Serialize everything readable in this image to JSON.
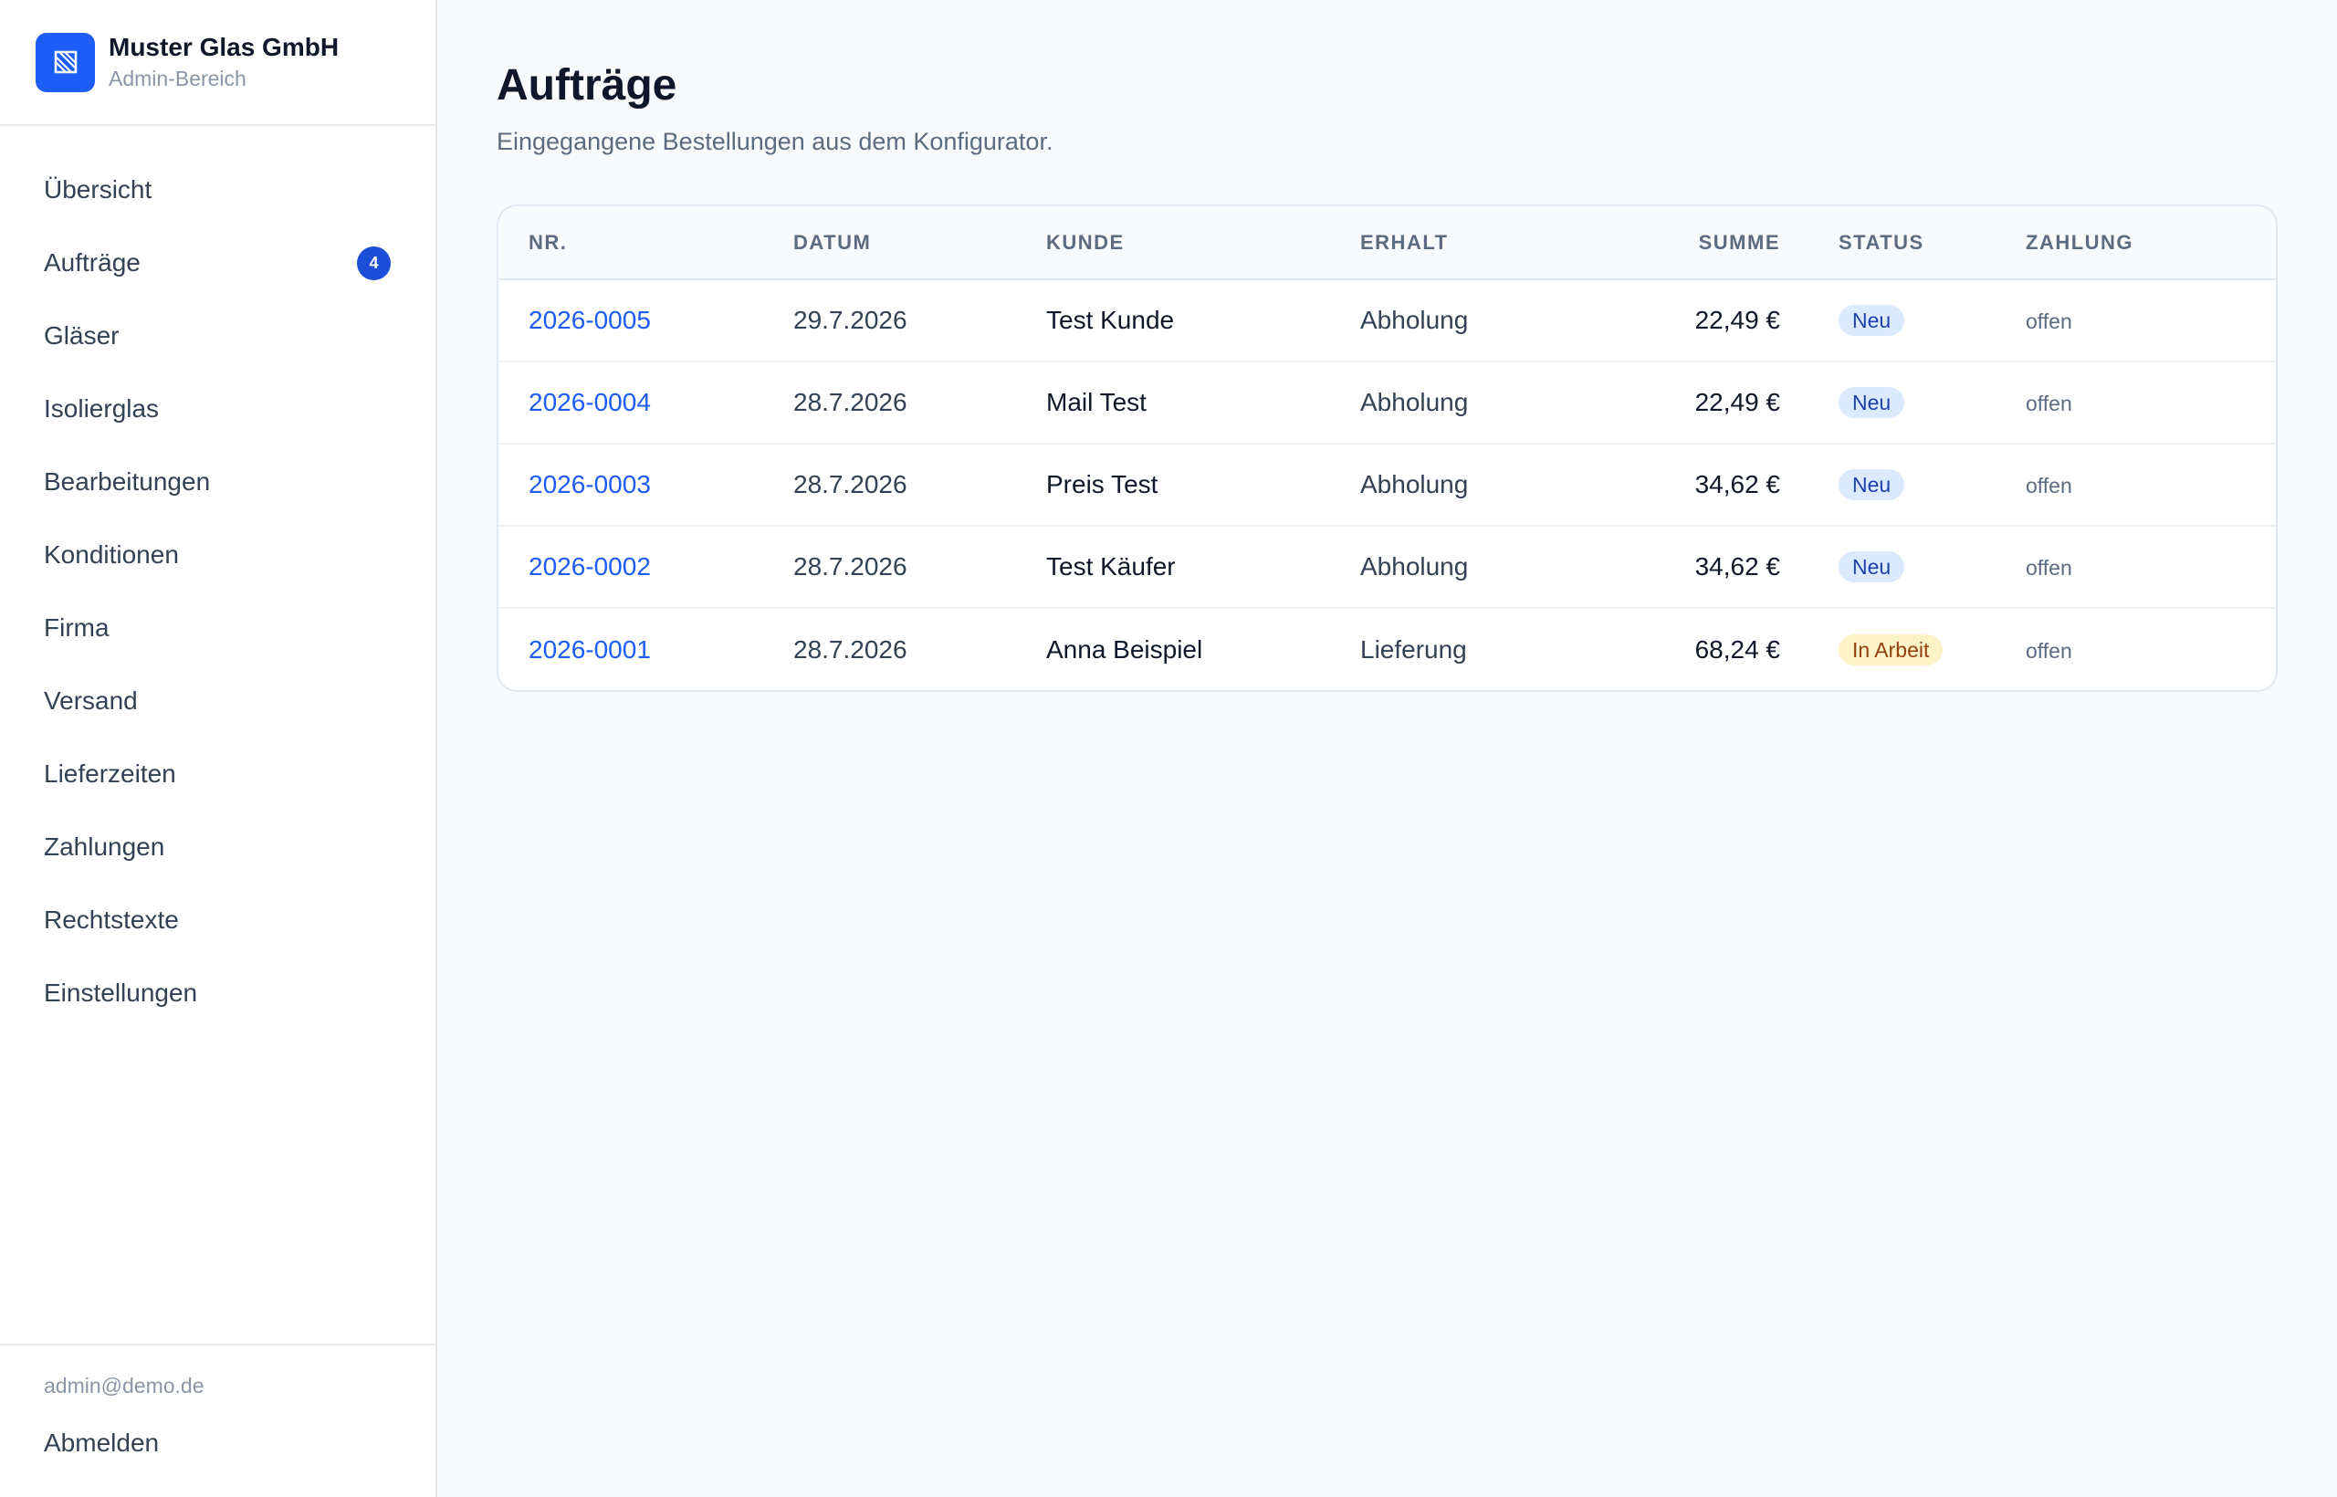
{
  "brand": {
    "name": "Muster Glas GmbH",
    "subtitle": "Admin-Bereich"
  },
  "nav": [
    {
      "label": "Übersicht"
    },
    {
      "label": "Aufträge",
      "badge": "4"
    },
    {
      "label": "Gläser"
    },
    {
      "label": "Isolierglas"
    },
    {
      "label": "Bearbeitungen"
    },
    {
      "label": "Konditionen"
    },
    {
      "label": "Firma"
    },
    {
      "label": "Versand"
    },
    {
      "label": "Lieferzeiten"
    },
    {
      "label": "Zahlungen"
    },
    {
      "label": "Rechtstexte"
    },
    {
      "label": "Einstellungen"
    }
  ],
  "footer": {
    "email": "admin@demo.de",
    "logout": "Abmelden"
  },
  "page": {
    "title": "Aufträge",
    "subtitle": "Eingegangene Bestellungen aus dem Konfigurator."
  },
  "table": {
    "columns": [
      "NR.",
      "DATUM",
      "KUNDE",
      "ERHALT",
      "SUMME",
      "STATUS",
      "ZAHLUNG"
    ],
    "rows": [
      {
        "nr": "2026-0005",
        "datum": "29.7.2026",
        "kunde": "Test Kunde",
        "erhalt": "Abholung",
        "summe": "22,49 €",
        "status": "Neu",
        "zahlung": "offen"
      },
      {
        "nr": "2026-0004",
        "datum": "28.7.2026",
        "kunde": "Mail Test",
        "erhalt": "Abholung",
        "summe": "22,49 €",
        "status": "Neu",
        "zahlung": "offen"
      },
      {
        "nr": "2026-0003",
        "datum": "28.7.2026",
        "kunde": "Preis Test",
        "erhalt": "Abholung",
        "summe": "34,62 €",
        "status": "Neu",
        "zahlung": "offen"
      },
      {
        "nr": "2026-0002",
        "datum": "28.7.2026",
        "kunde": "Test Käufer",
        "erhalt": "Abholung",
        "summe": "34,62 €",
        "status": "Neu",
        "zahlung": "offen"
      },
      {
        "nr": "2026-0001",
        "datum": "28.7.2026",
        "kunde": "Anna Beispiel",
        "erhalt": "Lieferung",
        "summe": "68,24 €",
        "status": "In Arbeit",
        "zahlung": "offen"
      }
    ]
  },
  "colors": {
    "accent": "#1d5cf5",
    "badge_new_bg": "#dbeafe",
    "badge_work_bg": "#fef3c7"
  },
  "icons": {
    "logo": "glass-pane-icon"
  }
}
